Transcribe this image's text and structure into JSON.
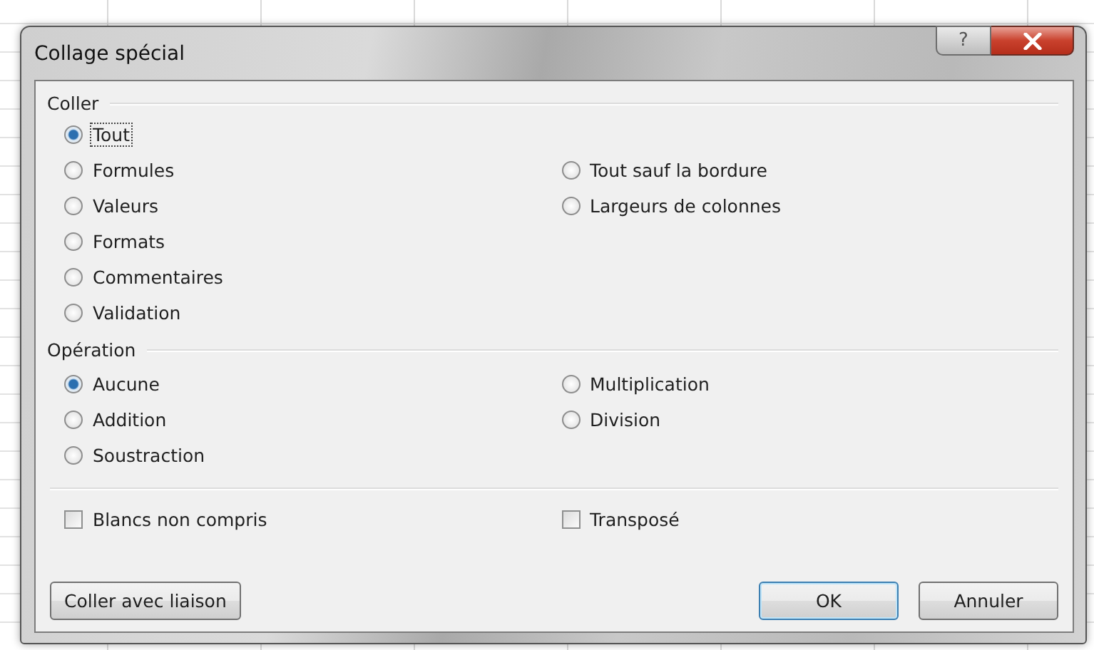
{
  "window": {
    "title": "Collage spécial",
    "help_button": "?"
  },
  "paste": {
    "title": "Coller",
    "options_left": [
      {
        "label": "Tout",
        "selected": true,
        "focused": true
      },
      {
        "label": "Formules",
        "selected": false,
        "focused": false
      },
      {
        "label": "Valeurs",
        "selected": false,
        "focused": false
      },
      {
        "label": "Formats",
        "selected": false,
        "focused": false
      },
      {
        "label": "Commentaires",
        "selected": false,
        "focused": false
      },
      {
        "label": "Validation",
        "selected": false,
        "focused": false
      }
    ],
    "options_right": [
      {
        "label": "Tout sauf la bordure",
        "selected": false,
        "focused": false
      },
      {
        "label": "Largeurs de colonnes",
        "selected": false,
        "focused": false
      }
    ]
  },
  "operation": {
    "title": "Opération",
    "options_left": [
      {
        "label": "Aucune",
        "selected": true
      },
      {
        "label": "Addition",
        "selected": false
      },
      {
        "label": "Soustraction",
        "selected": false
      }
    ],
    "options_right": [
      {
        "label": "Multiplication",
        "selected": false
      },
      {
        "label": "Division",
        "selected": false
      }
    ]
  },
  "checkboxes": [
    {
      "label": "Blancs non compris",
      "checked": false
    },
    {
      "label": "Transposé",
      "checked": false
    }
  ],
  "buttons": [
    {
      "label": "Coller avec liaison",
      "default": false
    },
    {
      "label": "OK",
      "default": true
    },
    {
      "label": "Annuler",
      "default": false
    }
  ]
}
